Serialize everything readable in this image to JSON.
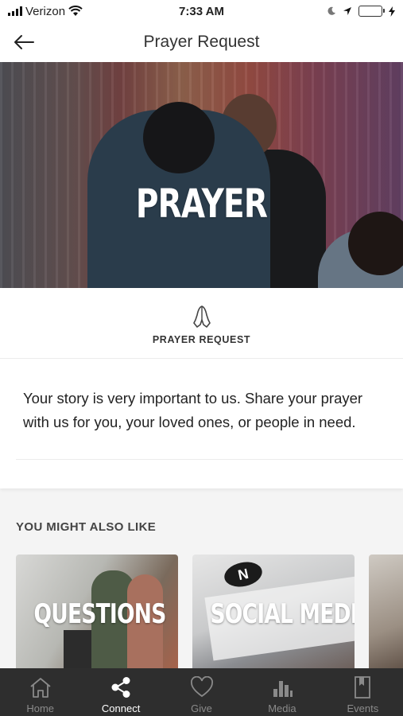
{
  "status_bar": {
    "carrier": "Verizon",
    "time": "7:33 AM"
  },
  "nav": {
    "title": "Prayer Request"
  },
  "hero": {
    "title": "PRAYER"
  },
  "card": {
    "section_label": "PRAYER REQUEST",
    "body": "Your story is very important to us. Share your prayer with us for you, your loved ones, or people in need."
  },
  "also_like": {
    "heading": "YOU MIGHT ALSO LIKE",
    "tiles": [
      {
        "label": "QUESTIONS"
      },
      {
        "label": "SOCIAL MEDIA"
      }
    ]
  },
  "tabs": [
    {
      "label": "Home",
      "icon": "home-icon",
      "active": false
    },
    {
      "label": "Connect",
      "icon": "share-icon",
      "active": true
    },
    {
      "label": "Give",
      "icon": "heart-icon",
      "active": false
    },
    {
      "label": "Media",
      "icon": "media-bars-icon",
      "active": false
    },
    {
      "label": "Events",
      "icon": "bookmark-book-icon",
      "active": false
    }
  ],
  "colors": {
    "tab_bar": "#2e2e2e",
    "tab_active": "#ffffff",
    "tab_inactive": "#8a8a8a",
    "battery": "#4cd964"
  }
}
